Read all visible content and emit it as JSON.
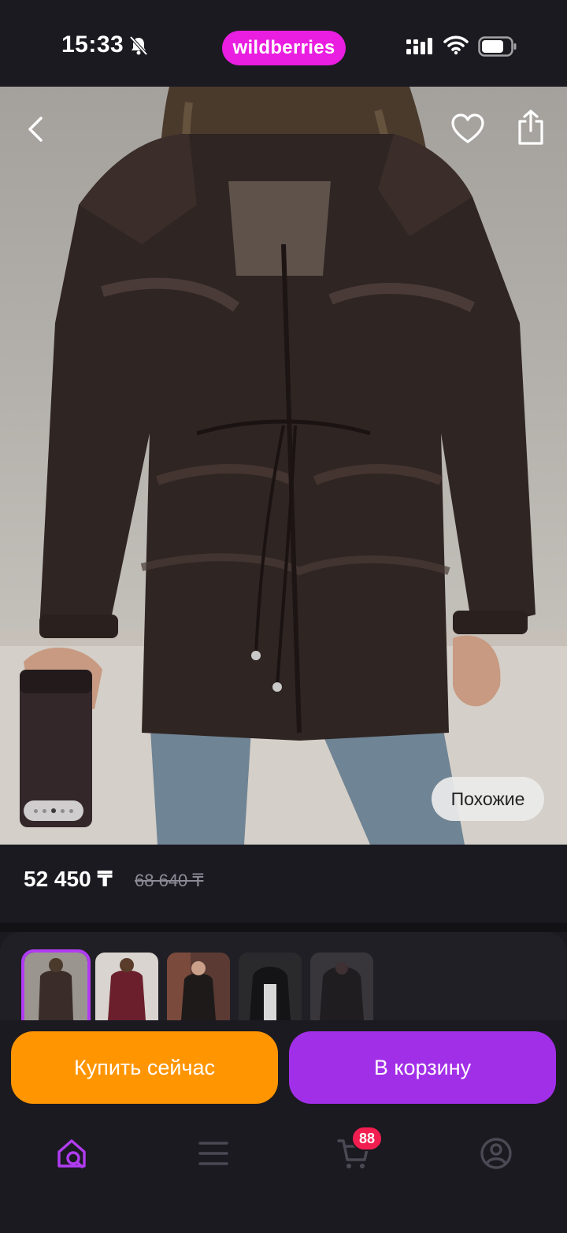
{
  "status_bar": {
    "time": "15:33",
    "brand": "wildberries",
    "brand_color": "#e91ee0"
  },
  "hero": {
    "back_icon": "chevron-left-icon",
    "favorite_icon": "heart-icon",
    "share_icon": "share-icon",
    "similar_label": "Похожие",
    "gallery_dots": 5,
    "gallery_active_index": 2
  },
  "price": {
    "current": "52 450 ₸",
    "old": "68 640 ₸"
  },
  "thumbnails": [
    {
      "name": "brown-jacket",
      "selected": true
    },
    {
      "name": "burgundy-jacket",
      "selected": false
    },
    {
      "name": "black-jacket-street",
      "selected": false
    },
    {
      "name": "black-jacket-hood",
      "selected": false
    },
    {
      "name": "black-jacket-dark",
      "selected": false
    }
  ],
  "actions": {
    "buy_now": "Купить сейчас",
    "add_to_cart": "В корзину",
    "buy_color": "#ff9500",
    "cart_color": "#a22fe8"
  },
  "bottom_nav": {
    "items": [
      "home-search-icon",
      "menu-icon",
      "cart-icon",
      "profile-icon"
    ],
    "cart_badge": "88",
    "active_color": "#b13cf2"
  }
}
